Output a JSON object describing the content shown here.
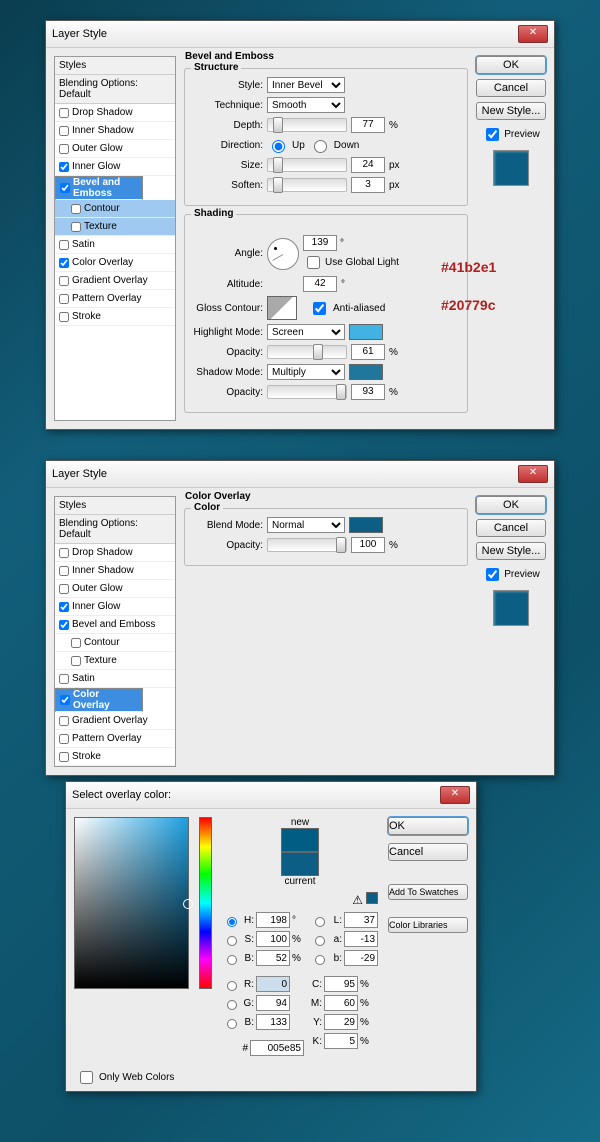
{
  "d1": {
    "title": "Layer Style",
    "styles_hdr": "Styles",
    "blend_hdr": "Blending Options: Default",
    "opts": [
      "Drop Shadow",
      "Inner Shadow",
      "Outer Glow",
      "Inner Glow",
      "Bevel and Emboss",
      "Contour",
      "Texture",
      "Satin",
      "Color Overlay",
      "Gradient Overlay",
      "Pattern Overlay",
      "Stroke"
    ],
    "checked": {
      "3": true,
      "4": true,
      "8": true
    },
    "panel_title": "Bevel and Emboss",
    "structure": "Structure",
    "style_lbl": "Style:",
    "style_val": "Inner Bevel",
    "tech_lbl": "Technique:",
    "tech_val": "Smooth",
    "depth_lbl": "Depth:",
    "depth_val": "77",
    "depth_u": "%",
    "dir_lbl": "Direction:",
    "dir_up": "Up",
    "dir_down": "Down",
    "size_lbl": "Size:",
    "size_val": "24",
    "size_u": "px",
    "soft_lbl": "Soften:",
    "soft_val": "3",
    "soft_u": "px",
    "shading": "Shading",
    "angle_lbl": "Angle:",
    "angle_val": "139",
    "angle_u": "°",
    "global": "Use Global Light",
    "alt_lbl": "Altitude:",
    "alt_val": "42",
    "alt_u": "°",
    "gc_lbl": "Gloss Contour:",
    "aa": "Anti-aliased",
    "hl_lbl": "Highlight Mode:",
    "hl_val": "Screen",
    "hl_color": "#41b2e1",
    "op_lbl": "Opacity:",
    "hl_op": "61",
    "op_u": "%",
    "sh_lbl": "Shadow Mode:",
    "sh_val": "Multiply",
    "sh_color": "#20779c",
    "sh_op": "93",
    "annot1": "#41b2e1",
    "annot2": "#20779c"
  },
  "btns": {
    "ok": "OK",
    "cancel": "Cancel",
    "newstyle": "New Style...",
    "preview": "Preview"
  },
  "d2": {
    "title": "Layer Style",
    "panel_title": "Color Overlay",
    "color_grp": "Color",
    "bm_lbl": "Blend Mode:",
    "bm_val": "Normal",
    "bm_color": "#0d5e85",
    "op_lbl": "Opacity:",
    "op_val": "100",
    "op_u": "%"
  },
  "d3": {
    "title": "Select overlay color:",
    "new": "new",
    "current": "current",
    "addsw": "Add To Swatches",
    "colorlib": "Color Libraries",
    "H": "H:",
    "Hv": "198",
    "Hu": "°",
    "S": "S:",
    "Sv": "100",
    "Su": "%",
    "B": "B:",
    "Bv": "52",
    "Bu": "%",
    "R": "R:",
    "Rv": "0",
    "G": "G:",
    "Gv": "94",
    "Bb": "B:",
    "Bbv": "133",
    "L": "L:",
    "Lv": "37",
    "a": "a:",
    "av": "-13",
    "b": "b:",
    "bv": "-29",
    "C": "C:",
    "Cv": "95",
    "Cu": "%",
    "M": "M:",
    "Mv": "60",
    "Mu": "%",
    "Y": "Y:",
    "Yv": "29",
    "Yu": "%",
    "K": "K:",
    "Kv": "5",
    "Ku": "%",
    "hash": "#",
    "hex": "005e85",
    "web": "Only Web Colors"
  }
}
